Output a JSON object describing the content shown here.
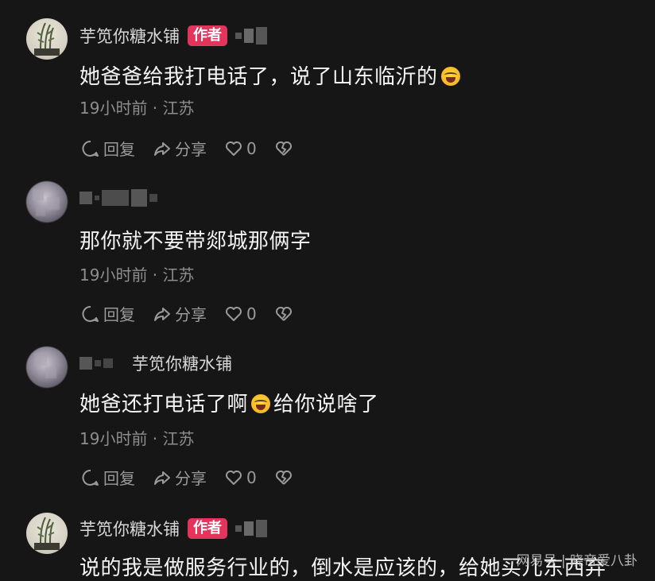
{
  "comments": [
    {
      "author": "芋笕你糖水铺",
      "badge": "作者",
      "text": "她爸爸给我打电话了，说了山东临沂的",
      "time_location": "19小时前 · 江苏",
      "actions": {
        "reply": "回复",
        "share": "分享",
        "likes": "0"
      }
    },
    {
      "author": "",
      "badge": "",
      "text": "那你就不要带郯城那俩字",
      "time_location": "19小时前 · 江苏",
      "actions": {
        "reply": "回复",
        "share": "分享",
        "likes": "0"
      }
    },
    {
      "author": "",
      "reply_to": "芋笕你糖水铺",
      "text_before_emoji": "她爸还打电话了啊",
      "text_after_emoji": "给你说啥了",
      "time_location": "19小时前 · 江苏",
      "actions": {
        "reply": "回复",
        "share": "分享",
        "likes": "0"
      }
    },
    {
      "author": "芋笕你糖水铺",
      "badge": "作者",
      "text": "说的我是做服务行业的，倒水是应该的，给她买儿东西弃"
    }
  ],
  "watermark": "网易号 | 晓帝爱八卦",
  "icons": {
    "reply": "comment-bubble-icon",
    "share": "share-arrow-icon",
    "like": "heart-icon",
    "dislike": "broken-heart-icon",
    "emoji": "crying-laughing-emoji"
  }
}
